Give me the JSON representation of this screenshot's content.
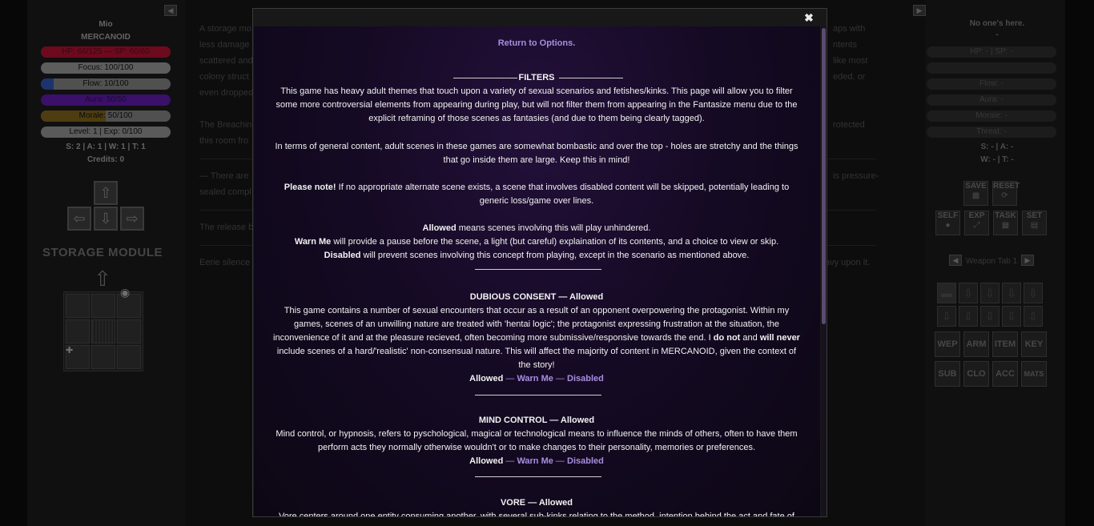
{
  "player": {
    "name": "Mio",
    "game": "MERCANOID",
    "hp_text": "HP: 66/125 — SP: 60/60",
    "focus": "Focus: 100/100",
    "flow": "Flow: 10/100",
    "aura": "Aura: 50/50",
    "morale": "Morale: 50/100",
    "level": "Level: 1 | Exp: 0/100",
    "stats": "S: 2 | A: 1 | W: 1 | T: 1",
    "credits": "Credits: 0",
    "colors": {
      "hp": "#b01234",
      "focus": "#8f8f8f",
      "flow": "#2b4fa8",
      "aura": "#6a1fb8",
      "morale": "#8a6a20"
    }
  },
  "map": {
    "area_title": "STORAGE MODULE"
  },
  "story": {
    "p1a": "A storage mo",
    "p1a_right": "aps with",
    "p1b": "less damage",
    "p1b_right": "ntents",
    "p1c": "scattered and",
    "p1c_right": "like most",
    "p1d": "colony struct",
    "p1d_right": "eded, or",
    "p1e": "even dropped",
    "p2a": "The Breaching",
    "p2a_right": "rotected",
    "p2b": "this room fro",
    "p3a": "— There are",
    "p3a_right": "is pressure-",
    "p3b": "sealed compl",
    "p4": "The release b",
    "p5": "Eerie silence",
    "p5_right": "avy upon it."
  },
  "enemy": {
    "title": "No one's here.",
    "dash": "-",
    "hp": "HP: - | SP: -",
    "flow": "Flow: -",
    "aura": "Aura: -",
    "morale": "Morale: -",
    "threat": "Threat: -",
    "stats1": "S: - | A: -",
    "stats2": "W: - | T: -"
  },
  "tools": {
    "save": "SAVE",
    "reset": "RESET",
    "self": "SELF",
    "exp": "EXP",
    "task": "TASK",
    "set": "SET"
  },
  "inventory": {
    "tab_label": "Weapon Tab 1",
    "categories": [
      "WEP",
      "ARM",
      "ITEM",
      "KEY",
      "SUB",
      "CLO",
      "ACC",
      "MATS"
    ]
  },
  "modal": {
    "close": "✖",
    "return_link": "Return to Options.",
    "filters_heading": "FILTERS",
    "intro1": "This game has heavy adult themes that touch upon a variety of sexual scenarios and fetishes/kinks. This page will allow you to filter",
    "intro2": "some more controversial elements from appearing during play, but will not filter them from appearing in the Fantasize menu due to the",
    "intro3": "explicit reframing of those scenes as fantasies (and due to them being clearly tagged).",
    "general1": "In terms of general content, adult scenes in these games are somewhat bombastic and over the top - holes are stretchy and the things",
    "general2": "that go inside them are large. Keep this in mind!",
    "note_bold": "Please note!",
    "note1": " If no appropriate alternate scene exists, a scene that involves disabled content will be skipped, potentially leading to",
    "note2": "generic loss/game over lines.",
    "allowed_bold": "Allowed",
    "allowed_text": " means scenes involving this will play unhindered.",
    "warn_bold": "Warn Me",
    "warn_text": " will provide a pause before the scene, a light (but careful) explaination of its contents, and a choice to view or skip.",
    "disabled_bold": "Disabled",
    "disabled_text": " will prevent scenes involving this concept from playing, except in the scenario as mentioned above.",
    "dubcon_heading": "DUBIOUS CONSENT — Allowed",
    "dubcon1": "This game contains a number of sexual encounters that occur as a result of an opponent overpowering the protagonist. Within my",
    "dubcon2": "games, scenes of an unwilling nature are treated with 'hentai logic'; the protagonist expressing frustration at the situation, the",
    "dubcon3": "inconvenience of it and at the pleasure recieved, often becoming more submissive/responsive towards the end. I",
    "dubcon3_b1": "do not",
    "dubcon3_mid": " and ",
    "dubcon3_b2": "will never",
    "dubcon4": "include scenes of a hard/'realistic' non-consensual nature. This will affect the majority of content in MERCANOID, given the context of",
    "dubcon5": "the story!",
    "opt_allowed": "Allowed",
    "opt_sep": " — ",
    "opt_warn": "Warn Me",
    "opt_disabled": "Disabled",
    "mind_heading": "MIND CONTROL — Allowed",
    "mind1": "Mind control, or hypnosis, refers to pyschological, magical or technological means to influence the minds of others, often to have them",
    "mind2": "perform acts they normally otherwise wouldn't or to make changes to their personality, memories or preferences.",
    "vore_heading": "VORE — Allowed",
    "vore1": "Vore centers around one entity consuming another, with several sub-kinks relating to the method, intention behind the act and fate of"
  }
}
